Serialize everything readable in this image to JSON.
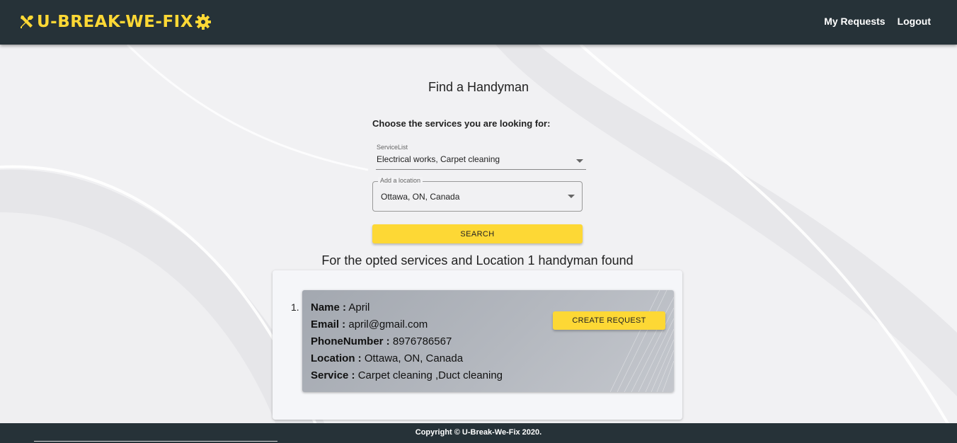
{
  "navbar": {
    "brand": "U-BREAK-WE-FIX",
    "links": [
      "My Requests",
      "Logout"
    ]
  },
  "search": {
    "title": "Find a Handyman",
    "choose_label": "Choose the services you are looking for:",
    "service_list_caption": "ServiceList",
    "service_list_value": "Electrical works, Carpet cleaning",
    "location_caption": "Add a location",
    "location_value": "Ottawa, ON, Canada",
    "search_button": "SEARCH"
  },
  "results": {
    "heading": "For the opted services and Location 1 handyman found",
    "items": [
      {
        "number": "1.",
        "name_label": "Name :",
        "name": "April",
        "email_label": "Email :",
        "email": "april@gmail.com",
        "phone_label": "PhoneNumber :",
        "phone": "8976786567",
        "location_label": "Location :",
        "location": "Ottawa, ON, Canada",
        "service_label": "Service :",
        "service": "Carpet cleaning ,Duct cleaning",
        "action": "CREATE REQUEST"
      }
    ]
  },
  "footer": {
    "copyright": "Copyright © U-Break-We-Fix 2020."
  },
  "colors": {
    "navbar": "#263238",
    "accent": "#fdd835",
    "card": "#b0b4bb"
  }
}
